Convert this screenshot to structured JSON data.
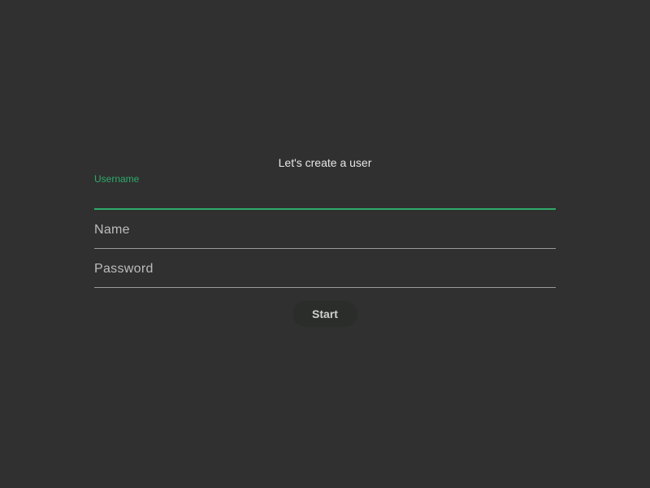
{
  "form": {
    "title": "Let's create a user",
    "fields": [
      {
        "label": "Username",
        "value": "",
        "state": "focused"
      },
      {
        "label": "Name",
        "value": "",
        "state": "idle"
      },
      {
        "label": "Password",
        "value": "",
        "state": "idle"
      }
    ],
    "submit_label": "Start"
  },
  "colors": {
    "background": "#303030",
    "accent": "#2eaa6a",
    "text": "#e6e6e6",
    "muted_text": "#bdbdbd",
    "divider": "#9a9a9a",
    "button_bg": "#2b2d2b",
    "button_text": "#cfcfcf"
  }
}
